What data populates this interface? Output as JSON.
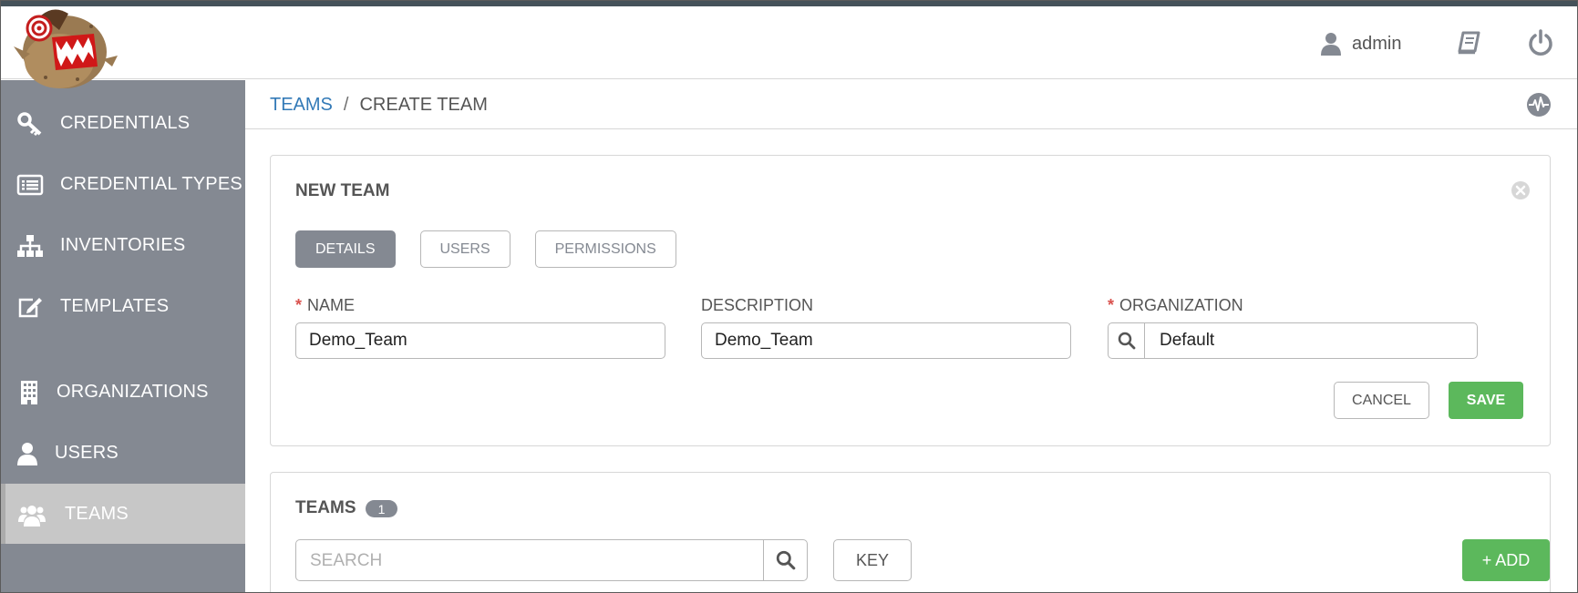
{
  "header": {
    "user": "admin",
    "icons": [
      "user-icon",
      "book-icon",
      "power-icon"
    ]
  },
  "sidebar": {
    "items": [
      {
        "label": "CREDENTIALS",
        "icon": "key-icon"
      },
      {
        "label": "CREDENTIAL TYPES",
        "icon": "list-icon"
      },
      {
        "label": "INVENTORIES",
        "icon": "sitemap-icon"
      },
      {
        "label": "TEMPLATES",
        "icon": "edit-icon"
      },
      {
        "label": "ORGANIZATIONS",
        "icon": "building-icon"
      },
      {
        "label": "USERS",
        "icon": "user-icon"
      },
      {
        "label": "TEAMS",
        "icon": "users-icon",
        "active": true
      }
    ]
  },
  "breadcrumb": {
    "parent": "TEAMS",
    "separator": "/",
    "current": "CREATE TEAM"
  },
  "form": {
    "title": "NEW TEAM",
    "tabs": [
      "DETAILS",
      "USERS",
      "PERMISSIONS"
    ],
    "active_tab": "DETAILS",
    "name_label": "NAME",
    "name_value": "Demo_Team",
    "description_label": "DESCRIPTION",
    "description_value": "Demo_Team",
    "organization_label": "ORGANIZATION",
    "organization_value": "Default",
    "required_mark": "*",
    "cancel_label": "CANCEL",
    "save_label": "SAVE"
  },
  "teams_list": {
    "title": "TEAMS",
    "count": "1",
    "search_placeholder": "SEARCH",
    "key_label": "KEY",
    "add_label": "+ ADD"
  },
  "colors": {
    "sidebar": "#848992",
    "active_nav": "#c7c7c7",
    "link": "#337ab7",
    "success": "#5cb85c",
    "required": "#d9534f"
  }
}
